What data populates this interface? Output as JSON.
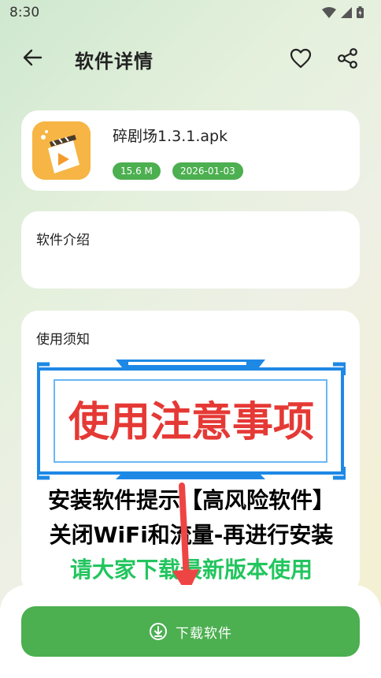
{
  "status_bar": {
    "time": "8:30",
    "icons": [
      "wifi-icon",
      "signal-icon",
      "battery-icon"
    ]
  },
  "header": {
    "title": "软件详情",
    "back_icon": "arrow-left-icon",
    "favorite_icon": "heart-icon",
    "share_icon": "share-icon"
  },
  "app": {
    "name": "碎剧场1.3.1.apk",
    "size": "15.6 M",
    "date": "2026-01-03",
    "icon": "app-logo-icon"
  },
  "intro": {
    "title": "软件介绍"
  },
  "notice": {
    "title": "使用须知",
    "image_lines": {
      "headline": "使用注意事项",
      "line1": "安装软件提示【高风险软件】",
      "line2": "关闭WiFi和流量-再进行安装",
      "line3": "请大家下载最新版本使用"
    }
  },
  "download": {
    "label": "下载软件",
    "icon": "download-icon"
  },
  "colors": {
    "accent": "#4caf50",
    "banner_blue": "#1e88e5",
    "headline_red": "#e53935",
    "line3_green": "#22c55e",
    "arrow_red": "#ef4444"
  }
}
